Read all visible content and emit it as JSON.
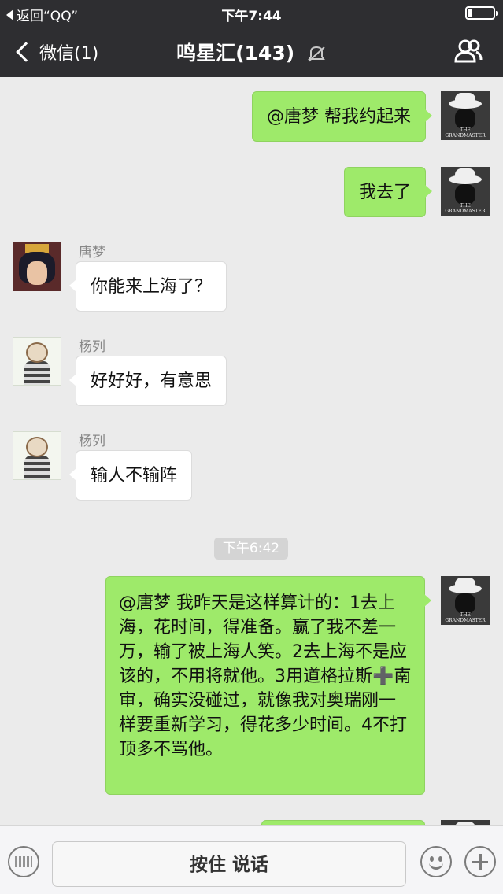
{
  "status_bar": {
    "back_app": "返回“QQ”",
    "time": "下午7:44",
    "battery_percent": 15
  },
  "nav": {
    "back_label": "微信(1)",
    "title": "鸣星汇(143)",
    "icons": [
      "chevron-left-icon",
      "mute-icon",
      "group-members-icon"
    ]
  },
  "messages": [
    {
      "side": "me",
      "text": "@唐梦 帮我约起来"
    },
    {
      "side": "me",
      "text": "我去了"
    },
    {
      "side": "them",
      "sender": "唐梦",
      "text": "你能来上海了？"
    },
    {
      "side": "them",
      "sender": "杨列",
      "text": "好好好，有意思"
    },
    {
      "side": "them",
      "sender": "杨列",
      "text": "输人不输阵"
    },
    {
      "side": "me",
      "text": "@唐梦 我昨天是这样算计的：1去上海，花时间，得准备。赢了我不差一万，输了被上海人笑。2去上海不是应该的，不用将就他。3用道格拉斯➕南审，确实没碰过，就像我对奥瑞刚一样要重新学习，得花多少时间。4不打顶多不骂他。"
    }
  ],
  "avatars": {
    "me_caption": "THE GRANDMASTER"
  },
  "timestamp": "下午6:42",
  "input": {
    "talk_label": "按住 说话"
  },
  "colors": {
    "header": "#2e2e31",
    "my_bubble": "#9eea6a",
    "their_bubble": "#ffffff",
    "chat_bg": "#ebebeb"
  }
}
